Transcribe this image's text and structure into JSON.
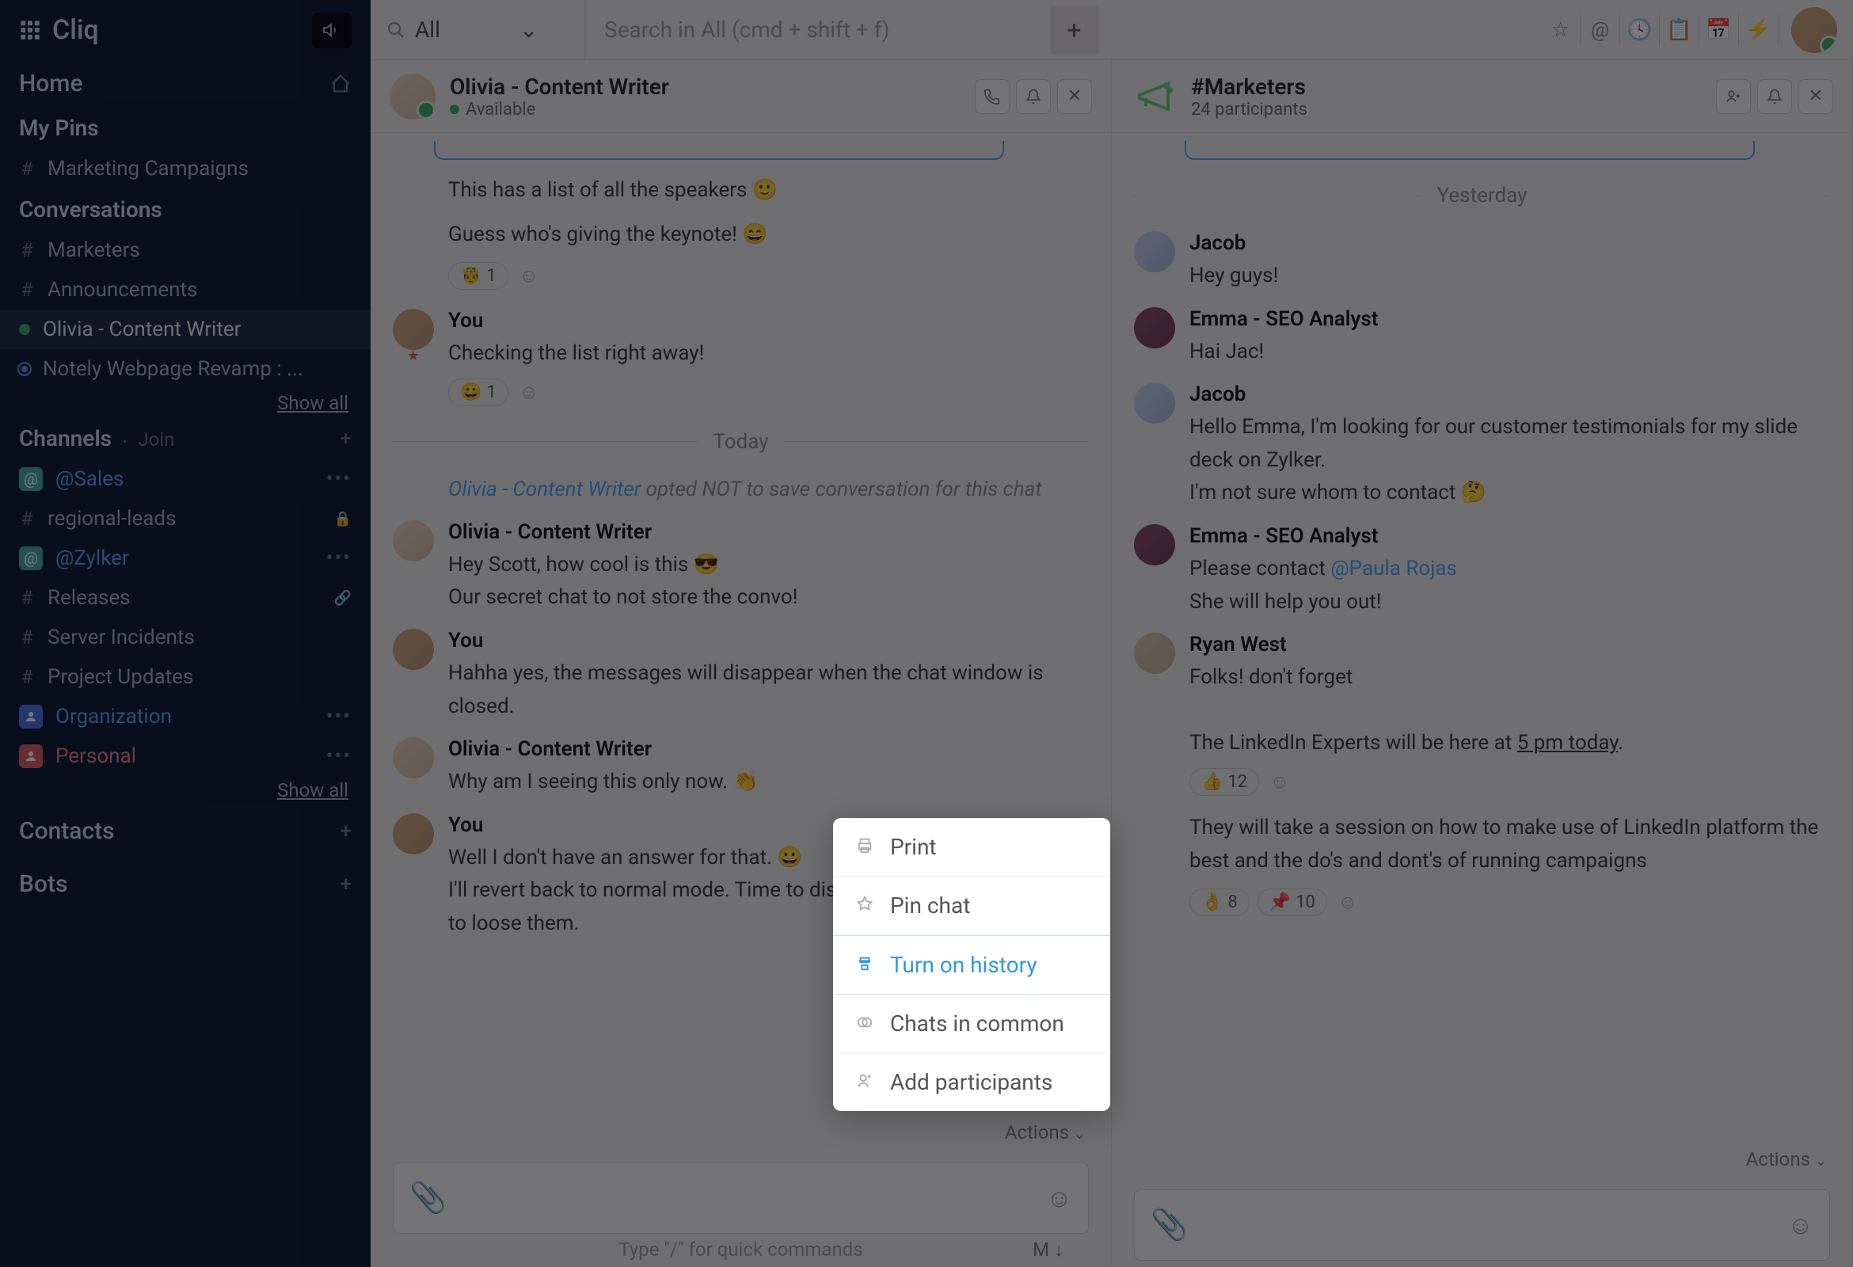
{
  "app": {
    "name": "Cliq"
  },
  "sidebar": {
    "home": "Home",
    "pins_title": "My Pins",
    "pins": [
      {
        "label": "Marketing Campaigns"
      }
    ],
    "conversations_title": "Conversations",
    "conversations": [
      {
        "label": "Marketers",
        "type": "hash"
      },
      {
        "label": "Announcements",
        "type": "hash"
      },
      {
        "label": "Olivia - Content Writer",
        "type": "dot",
        "active": true
      },
      {
        "label": "Notely Webpage Revamp : ...",
        "type": "ring"
      }
    ],
    "show_all": "Show all",
    "channels_title": "Channels",
    "join_label": "Join",
    "channels": [
      {
        "label": "@Sales",
        "icon": "teal",
        "at": true,
        "color_text": "blue-text"
      },
      {
        "label": "regional-leads",
        "icon": "hash",
        "locked": true
      },
      {
        "label": "@Zylker",
        "icon": "teal",
        "at": true,
        "color_text": "blue-text"
      },
      {
        "label": "Releases",
        "icon": "hash",
        "link": true
      },
      {
        "label": "Server Incidents",
        "icon": "hash"
      },
      {
        "label": "Project Updates",
        "icon": "hash"
      },
      {
        "label": "Organization",
        "icon": "blue",
        "color_text": "blue-text"
      },
      {
        "label": "Personal",
        "icon": "red",
        "color_text": "red-text"
      }
    ],
    "contacts": "Contacts",
    "bots": "Bots"
  },
  "topbar": {
    "filter_label": "All",
    "search_placeholder": "Search in All (cmd + shift + f)"
  },
  "pane_left": {
    "name": "Olivia - Content Writer",
    "status": "Available",
    "pre_lines": [
      "This has a list of all the speakers  🙂",
      "Guess who's giving the keynote!  😄"
    ],
    "reaction_1": {
      "emoji": "🤴",
      "count": "1"
    },
    "msgs": [
      {
        "sender": "You",
        "avatar": "you star",
        "lines": [
          "Checking  the list right away!"
        ],
        "reaction": {
          "emoji": "😀",
          "count": "1"
        }
      },
      {
        "separator": "Today"
      },
      {
        "system": true,
        "who": "Olivia - Content Writer",
        "text": " opted NOT to save conversation for this chat"
      },
      {
        "sender": "Olivia - Content Writer",
        "avatar": "olivia",
        "lines": [
          "Hey Scott, how cool is this  😎",
          "Our secret chat to not store the convo!"
        ]
      },
      {
        "sender": "You",
        "avatar": "you",
        "lines": [
          "Hahha yes, the messages will disappear when the chat window is closed."
        ]
      },
      {
        "sender": "Olivia - Content Writer",
        "avatar": "olivia",
        "lines": [
          "Why am I seeing this only now.  👏"
        ]
      },
      {
        "sender": "You",
        "avatar": "you",
        "lines": [
          "Well I don't have an answer for that.  😀",
          "I'll revert back to normal mode. Time to discuss the slides. Don't want to loose them."
        ]
      }
    ],
    "actions_label": "Actions",
    "hint": "Type \"/\" for quick commands",
    "mode": "M ↓"
  },
  "pane_right": {
    "name": "#Marketers",
    "status": "24 participants",
    "separator": "Yesterday",
    "msgs": [
      {
        "sender": "Jacob",
        "avatar": "jacob",
        "lines": [
          "Hey guys!"
        ]
      },
      {
        "sender": "Emma - SEO Analyst",
        "avatar": "emma",
        "lines": [
          "Hai Jac!"
        ]
      },
      {
        "sender": "Jacob",
        "avatar": "jacob",
        "lines": [
          "Hello Emma, I'm looking for our customer testimonials for my slide deck on Zylker.",
          " I'm not sure whom to contact  🤔"
        ]
      },
      {
        "sender": "Emma - SEO Analyst",
        "avatar": "emma",
        "lines_html": [
          "Please contact <span class='mention'>@Paula Rojas</span>",
          " She will help you out!"
        ]
      },
      {
        "sender": "Ryan West",
        "avatar": "ryan",
        "lines_html": [
          "Folks! don't forget",
          "",
          "The LinkedIn Experts will be here at <span class='underlined'>5 pm today</span>."
        ],
        "reaction": {
          "emoji": "👍",
          "count": "12"
        }
      },
      {
        "continue": true,
        "lines": [
          "They will take a session on how to make use of LinkedIn platform the best and the do's and dont's of running campaigns"
        ],
        "reactions": [
          {
            "emoji": "👌",
            "count": "8"
          },
          {
            "emoji": "📌",
            "count": "10"
          }
        ]
      }
    ],
    "actions_label": "Actions"
  },
  "popup": {
    "items": [
      {
        "icon": "🖨",
        "label": "Print"
      },
      {
        "icon": "📌",
        "label": "Pin chat"
      },
      {
        "icon": "🔄",
        "label": "Turn on history",
        "active": true
      },
      {
        "icon": "⊚",
        "label": "Chats in common"
      },
      {
        "icon": "👤⁺",
        "label": "Add participants"
      }
    ]
  }
}
